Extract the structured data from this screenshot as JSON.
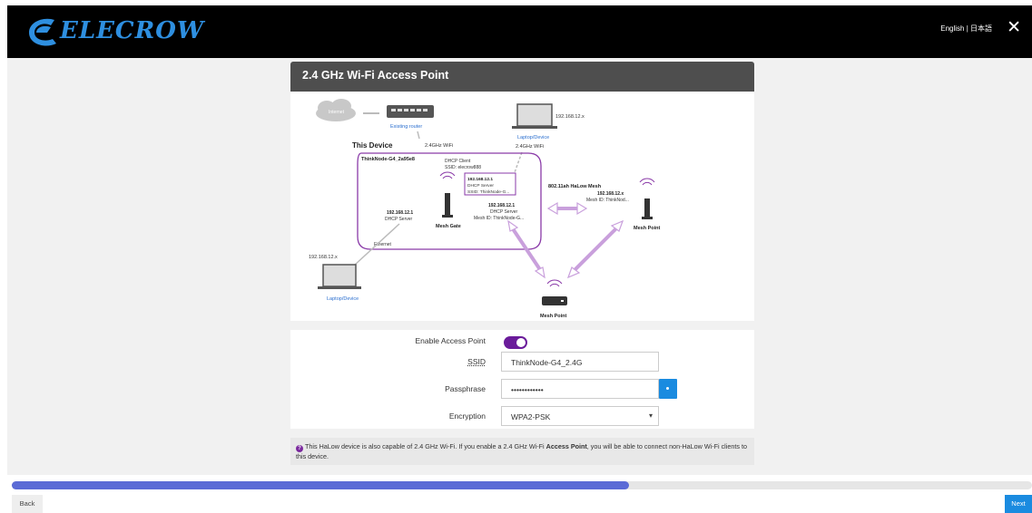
{
  "header": {
    "logo_text": "ELECROW",
    "language_links": "English | 日本語",
    "close_icon": "close-icon"
  },
  "panel": {
    "title": "2.4 GHz Wi-Fi Access Point"
  },
  "diagram": {
    "internet": "Internet",
    "existing_router": "Existing router",
    "top_laptop_ip": "192.168.12.x",
    "top_laptop_label": "Laptop/Device",
    "wifi_left": "2.4GHz WiFi",
    "wifi_right": "2.4GHz WiFi",
    "this_device": "This Device",
    "device_name": "ThinkNode-G4_2a95e8",
    "dhcp_client": "DHCP Client",
    "ssid_client": "SSID: elecrow888",
    "box_ip": "192.168.12.1",
    "box_dhcp": "DHCP Server",
    "box_ssid": "SSID: ThinkNode-G...",
    "halow": "802.11ah HaLow Mesh",
    "mesh_server_ip": "192.168.12.1",
    "mesh_server_dhcp": "DHCP Server",
    "mesh_server_id": "Mesh ID: ThinkNode-G...",
    "left_ip": "192.168.12.1",
    "left_dhcp": "DHCP Server",
    "mesh_gate": "Mesh Gate",
    "ethernet": "Ethernet",
    "right_ip": "192.168.12.x",
    "right_mesh_id": "Mesh ID: ThinkNod...",
    "mesh_point_right": "Mesh Point",
    "bottom_laptop_ip": "192.168.12.x",
    "bottom_laptop_label": "Laptop/Device",
    "mesh_point_bottom": "Mesh Point"
  },
  "form": {
    "enable_label": "Enable Access Point",
    "enable_value": true,
    "ssid_label": "SSID",
    "ssid_value": "ThinkNode-G4_2.4G",
    "pass_label": "Passphrase",
    "pass_value": "••••••••••••",
    "enc_label": "Encryption",
    "enc_value": "WPA2-PSK"
  },
  "info": {
    "text_before": "This HaLow device is also capable of 2.4 GHz Wi-Fi. If you enable a 2.4 GHz Wi-Fi ",
    "text_bold": "Access Point",
    "text_after": ", you will be able to connect non-HaLow Wi-Fi clients to this device."
  },
  "progress": {
    "fraction": 0.605
  },
  "footer": {
    "back_label": "Back",
    "next_label": "Next"
  },
  "colors": {
    "accent_purple": "#6a1b9a",
    "primary_blue": "#1a8be0",
    "progress_blue": "#5b6bd6"
  }
}
